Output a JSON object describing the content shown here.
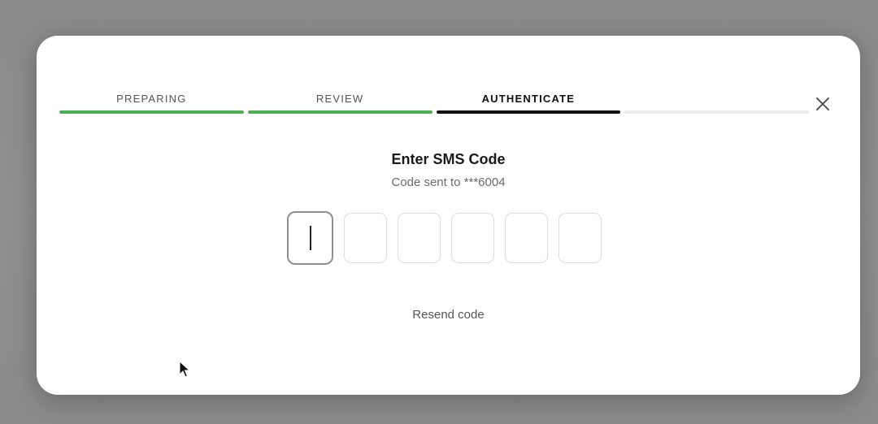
{
  "steps": [
    {
      "label": "PREPARING",
      "state": "done"
    },
    {
      "label": "REVIEW",
      "state": "done"
    },
    {
      "label": "AUTHENTICATE",
      "state": "active"
    },
    {
      "label": "",
      "state": "pending"
    }
  ],
  "dialog": {
    "title": "Enter SMS Code",
    "subtitle": "Code sent to ***6004",
    "resend_label": "Resend code",
    "code_length": 6,
    "code_values": [
      "",
      "",
      "",
      "",
      "",
      ""
    ]
  },
  "icons": {
    "close": "close-icon",
    "cursor": "mouse-pointer-icon"
  },
  "colors": {
    "done": "#4caf50",
    "active": "#111111",
    "pending": "#ebebeb"
  }
}
